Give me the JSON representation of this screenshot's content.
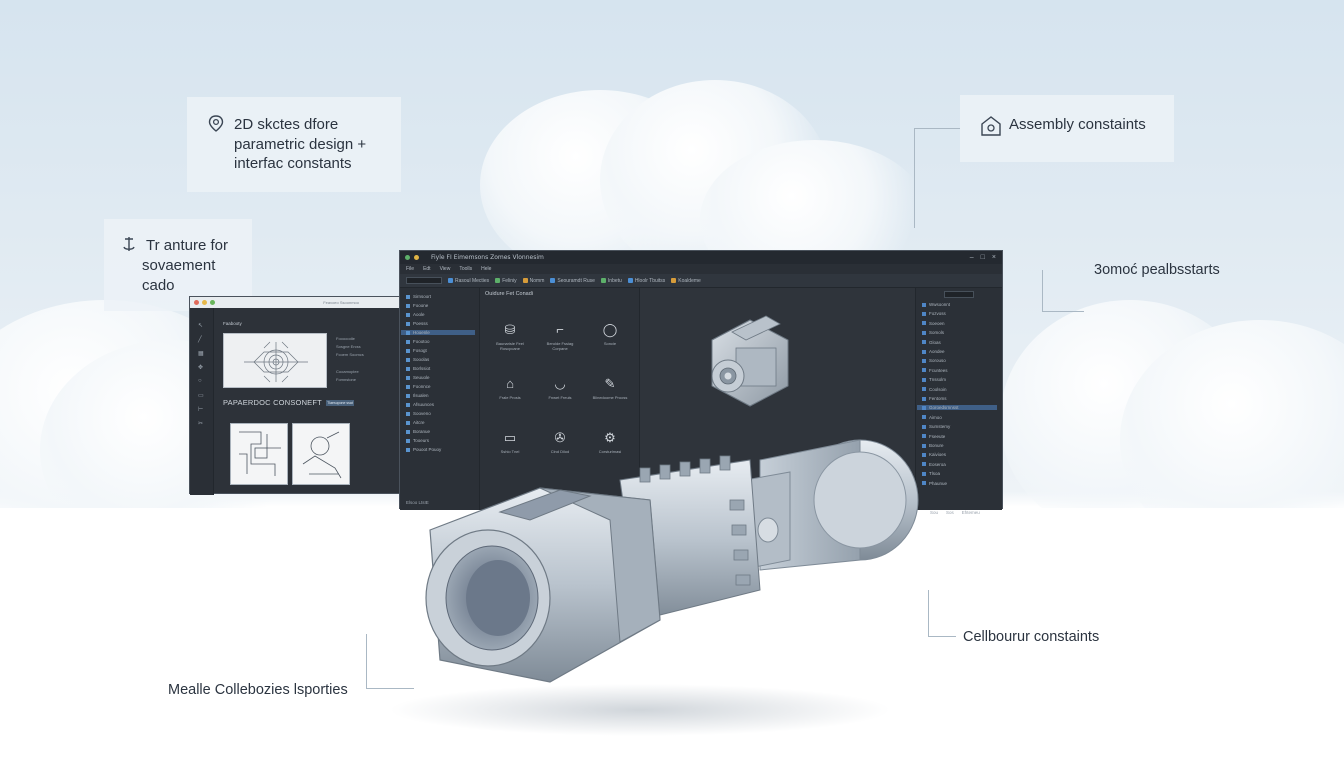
{
  "callouts": {
    "sketch": {
      "icon": "pin-icon",
      "line1": "2D skctes dfore",
      "line2": "parametric design +",
      "line3": "interfac constants"
    },
    "transfer": {
      "icon": "anchor-icon",
      "line1": "Tr anture for",
      "line2": "sovaement",
      "line3": "cado"
    },
    "assembly": {
      "icon": "home-shield-icon",
      "text": "Assembly constaints"
    },
    "right_label": "3omoć pealbsstarts",
    "collab_label": "Cellbourur constaints",
    "bottom_label": "Mealle Collebozies lsporties"
  },
  "main_window": {
    "title": "Fiyle  FI  Eimemsons  Zomes Vlonnesim",
    "menu": [
      "File",
      "Edt",
      "View",
      "Toolls",
      "Hele"
    ],
    "toolbar": [
      "Rasoul Mecties",
      "Feliniy",
      "Nomm",
      "Seouramdt Ruse",
      "Inbetu",
      "Hloolr Tbuitss",
      "Koaldeme"
    ],
    "left_tree": [
      "Sirnsoort",
      "Fooone",
      "Aoole",
      "Poesss",
      "Hooenle",
      "Foootoo",
      "Fosogt",
      "Sooolas",
      "Borlssiot",
      "Seuuole",
      "Foonnce",
      "Ilsualen",
      "Afsuunces",
      "Sooveno",
      "Aitcre",
      "Boranue",
      "Tooeurs",
      "Pouoot Pouoy"
    ],
    "mid_title": "Ouidure Fet Conadi",
    "tools": [
      {
        "icon": "cylinder-icon",
        "label": "Baunarisle Feel Roscpcane"
      },
      {
        "icon": "bend-icon",
        "label": "Berolde Fssiag Corpane"
      },
      {
        "icon": "circle-icon",
        "label": "Soncie"
      },
      {
        "icon": "house-icon",
        "label": "Frale Prosis"
      },
      {
        "icon": "bowl-icon",
        "label": "Fnwet Freuls"
      },
      {
        "icon": "pen-icon",
        "label": "Blinedoome Prooss"
      },
      {
        "icon": "pipe-icon",
        "label": "Sshio Tnel"
      },
      {
        "icon": "wrench-icon",
        "label": "Clnd Dilod"
      },
      {
        "icon": "gears-icon",
        "label": "Corsturlmasi"
      }
    ],
    "right_tree": [
      "Wwsoonnt",
      "Fozvoss",
      "Soeoen",
      "Somols",
      "Gloas",
      "Aondee",
      "Sorouso",
      "Fcuntees",
      "Tnssolm",
      "Coolsoin",
      "Fentoms",
      "Goroedsrnnsst",
      "Aimoo",
      "Sumstemy",
      "Fseeute",
      "Bonure",
      "Kaivioes",
      "Eoseroa",
      "Tlsoa",
      "Phaunue"
    ],
    "status": "Elsoo LtsIE",
    "status_right": [
      "Sou",
      "Sos",
      "Ehtemeu"
    ]
  },
  "secondary_window": {
    "title": "Feavoeo Ssoonmoo",
    "panel_title": "Faabooty",
    "heading": "PAPAERDOC CONSONEFT",
    "chip": "Tlaesupone ssat",
    "props": [
      "Fooooodle",
      "Sosgne Ercss",
      "Fcoem Soomcs",
      "Cooamoplee",
      "Fomnstone"
    ]
  },
  "colors": {
    "accent": "#4b8fd6",
    "window_bg": "#2c3138",
    "selected": "#3f5f87"
  }
}
